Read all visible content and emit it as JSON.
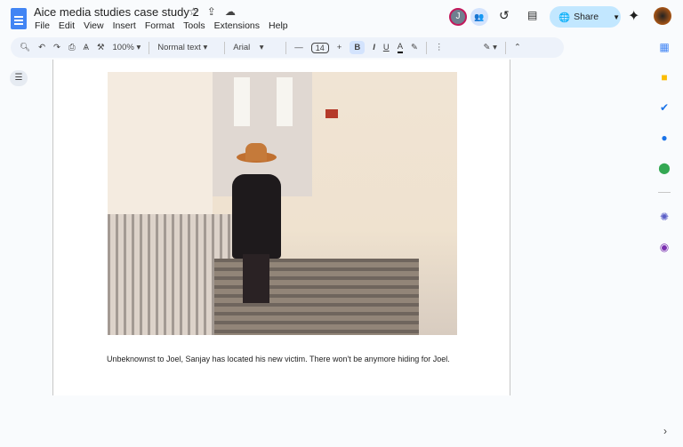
{
  "doc": {
    "title": "Aice media studies case study 2"
  },
  "menu": [
    "File",
    "Edit",
    "View",
    "Insert",
    "Format",
    "Tools",
    "Extensions",
    "Help"
  ],
  "toolbar": {
    "zoom": "100%",
    "style": "Normal text",
    "font": "Arial",
    "font_size": "14",
    "bold": "B",
    "italic": "I",
    "underline": "U",
    "text_color": "A"
  },
  "header": {
    "avatar_initial": "J",
    "share_label": "Share"
  },
  "body": {
    "caption": "Unbeknownst to Joel, Sanjay has located his new victim. There won't be anymore hiding for Joel."
  },
  "colors": {
    "accent": "#c2e7ff",
    "doc_blue": "#4285f4"
  }
}
